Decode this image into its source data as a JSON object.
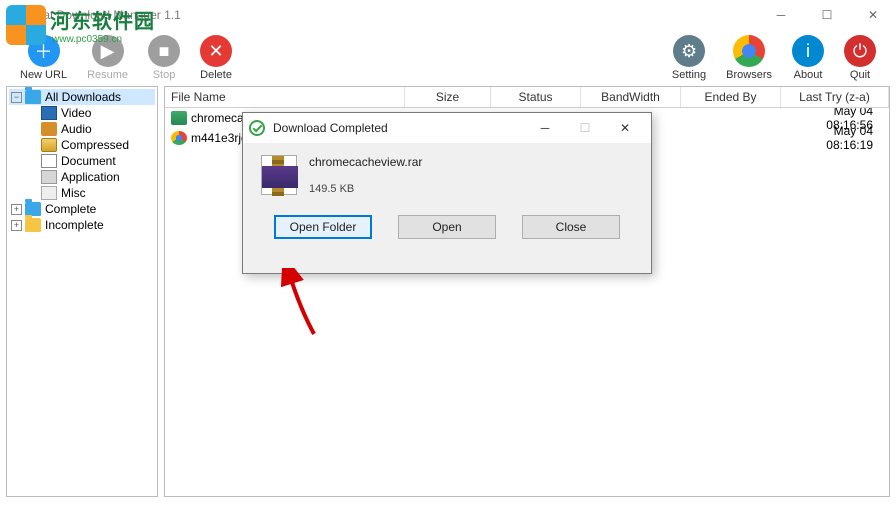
{
  "window": {
    "title": "Neat Download Manager 1.1"
  },
  "watermark": {
    "cn": "河东软件园",
    "sub": "www.pc0359.cn"
  },
  "toolbar": {
    "newurl": "New URL",
    "resume": "Resume",
    "stop": "Stop",
    "delete": "Delete",
    "setting": "Setting",
    "browsers": "Browsers",
    "about": "About",
    "quit": "Quit"
  },
  "tree": {
    "all": "All Downloads",
    "video": "Video",
    "audio": "Audio",
    "compressed": "Compressed",
    "document": "Document",
    "application": "Application",
    "misc": "Misc",
    "complete": "Complete",
    "incomplete": "Incomplete"
  },
  "columns": {
    "filename": "File Name",
    "size": "Size",
    "status": "Status",
    "bandwidth": "BandWidth",
    "endedby": "Ended By",
    "lasttry": "Last Try (z-a)"
  },
  "rows": [
    {
      "icon": "rar",
      "name": "chromecacheview.rar",
      "last": "May 04 08:16:56"
    },
    {
      "icon": "chrome",
      "name": "m441e3rjq9",
      "last": "May 04 08:16:19"
    }
  ],
  "dialog": {
    "title": "Download Completed",
    "filename": "chromecacheview.rar",
    "filesize": "149.5 KB",
    "open_folder": "Open Folder",
    "open": "Open",
    "close": "Close"
  }
}
